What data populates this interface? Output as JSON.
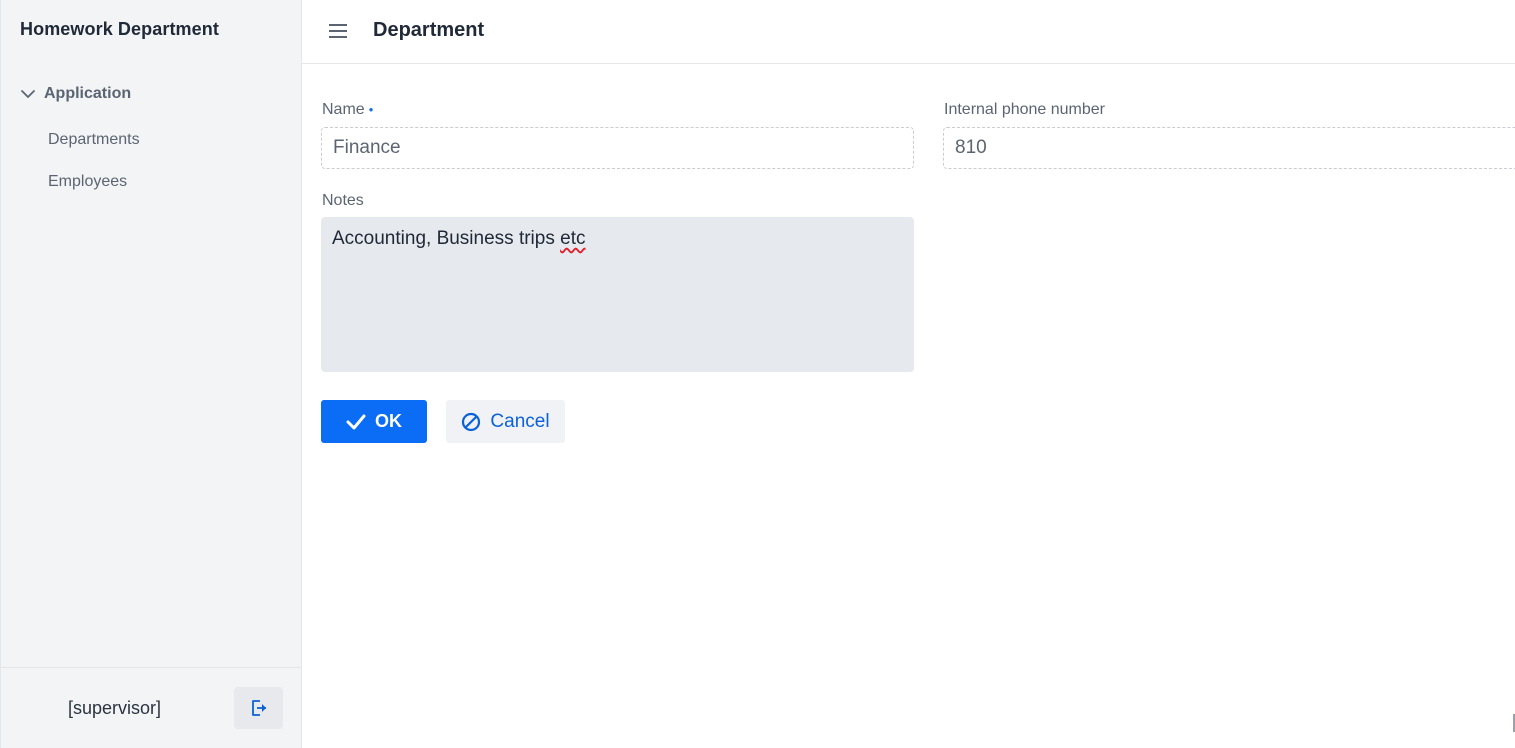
{
  "sidebar": {
    "app_title": "Homework Department",
    "group": {
      "label": "Application",
      "icon": "chevron-down-icon"
    },
    "items": [
      {
        "label": "Departments"
      },
      {
        "label": "Employees"
      }
    ],
    "footer": {
      "user": "[supervisor]",
      "logout_icon": "logout-icon"
    }
  },
  "header": {
    "menu_icon": "hamburger-icon",
    "title": "Department"
  },
  "form": {
    "name": {
      "label": "Name",
      "required_marker": "•",
      "value": "Finance"
    },
    "phone": {
      "label": "Internal phone number",
      "value": "810"
    },
    "notes": {
      "label": "Notes",
      "value_prefix": "Accounting, Business trips ",
      "value_misspelled": "etc"
    }
  },
  "actions": {
    "ok_label": "OK",
    "cancel_label": "Cancel"
  },
  "colors": {
    "accent": "#0b6cf5",
    "link": "#0b62d8",
    "sidebar_bg": "#f3f4f6",
    "textarea_bg": "#e6e9ed"
  }
}
